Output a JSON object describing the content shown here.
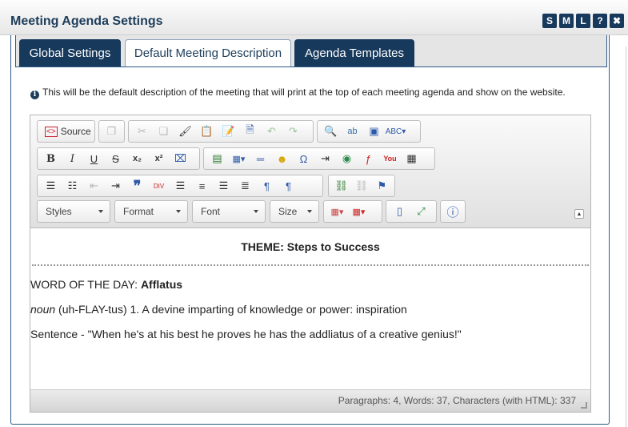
{
  "window": {
    "title": "Meeting Agenda Settings",
    "controls": [
      "S",
      "M",
      "L",
      "?",
      "✖"
    ]
  },
  "tabs": [
    {
      "label": "Global Settings"
    },
    {
      "label": "Default Meeting Description"
    },
    {
      "label": "Agenda Templates"
    }
  ],
  "info_text": "This will be the default description of the meeting that will print at the top of each meeting agenda and show on the website.",
  "toolbar": {
    "source_label": "Source",
    "styles_label": "Styles",
    "format_label": "Format",
    "font_label": "Font",
    "size_label": "Size",
    "icons": [
      "source-icon",
      "templates-icon",
      "cut-icon",
      "copy-icon",
      "paste-brush-icon",
      "paste-icon",
      "paste-text-icon",
      "paste-word-icon",
      "undo-icon",
      "redo-icon",
      "find-icon",
      "replace-icon",
      "select-all-icon",
      "spellcheck-icon",
      "bold-icon",
      "italic-icon",
      "underline-icon",
      "strike-icon",
      "subscript-icon",
      "superscript-icon",
      "remove-format-icon",
      "image-icon",
      "table-icon",
      "horizontal-rule-icon",
      "smiley-icon",
      "special-char-icon",
      "page-break-icon",
      "iframe-icon",
      "flash-icon",
      "youtube-icon",
      "media-icon",
      "numbered-list-icon",
      "bulleted-list-icon",
      "outdent-icon",
      "indent-icon",
      "blockquote-icon",
      "div-icon",
      "align-left-icon",
      "align-center-icon",
      "align-right-icon",
      "justify-icon",
      "ltr-icon",
      "rtl-icon",
      "link-icon",
      "unlink-icon",
      "anchor-icon",
      "text-color-icon",
      "bg-color-icon",
      "show-blocks-icon",
      "maximize-icon",
      "about-icon"
    ]
  },
  "content": {
    "theme": "THEME: Steps to Success",
    "word_prefix": "WORD OF THE DAY: ",
    "word": "Afflatus",
    "noun_label": "noun",
    "definition": " (uh-FLAY-tus) 1. A devine imparting of knowledge or power: inspiration",
    "sentence": "Sentence - \"When he's at his best he proves he has the addliatus of a creative genius!\""
  },
  "status": "Paragraphs: 4, Words: 37, Characters (with HTML): 337",
  "colors": {
    "brand": "#16395c",
    "accent": "#2b5a87"
  }
}
